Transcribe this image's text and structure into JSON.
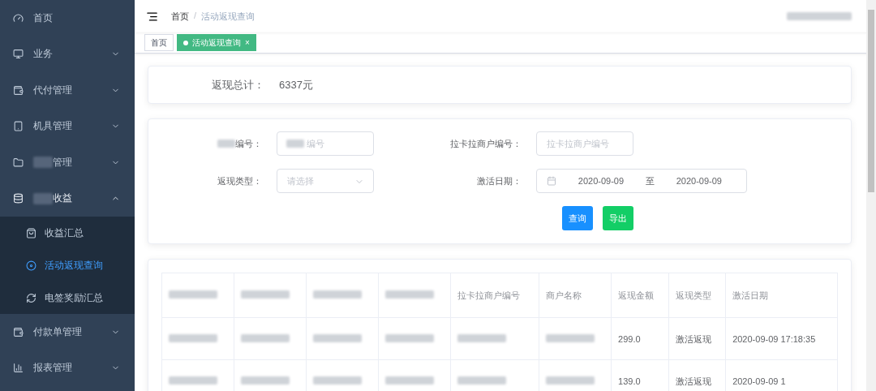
{
  "sidebar": {
    "items": [
      {
        "label": "首页",
        "masked": false
      },
      {
        "label": "业务",
        "masked": false,
        "expanded": false
      },
      {
        "label": "代付管理",
        "masked": false,
        "expanded": false
      },
      {
        "label": "机具管理",
        "masked": false,
        "expanded": false
      },
      {
        "label": "管理",
        "masked": true,
        "expanded": false
      },
      {
        "label": "收益",
        "masked": true,
        "expanded": true,
        "children": [
          {
            "label": "收益汇总",
            "selected": false
          },
          {
            "label": "活动返现查询",
            "selected": true
          },
          {
            "label": "电签奖励汇总",
            "selected": false
          }
        ]
      },
      {
        "label": "付款单管理",
        "masked": false,
        "expanded": false
      },
      {
        "label": "报表管理",
        "masked": false,
        "expanded": false
      }
    ]
  },
  "breadcrumb": {
    "items": [
      "首页",
      "活动返现查询"
    ],
    "separator": "/"
  },
  "header": {
    "user_masked": true
  },
  "tags": [
    {
      "label": "首页",
      "selected": false,
      "closable": false
    },
    {
      "label": "活动返现查询",
      "selected": true,
      "closable": true,
      "close": "×"
    }
  ],
  "summary": {
    "label": "返现总计：",
    "value": "6337元"
  },
  "filters": [
    {
      "kind": "input",
      "label": "编号：",
      "label_masked": true,
      "placeholder": "编号",
      "placeholder_masked": true
    },
    {
      "kind": "input",
      "label": "拉卡拉商户编号：",
      "label_masked": false,
      "placeholder": "拉卡拉商户编号",
      "placeholder_masked": false
    },
    {
      "kind": "select",
      "label": "返现类型：",
      "label_masked": false,
      "placeholder": "请选择",
      "placeholder_masked": false
    },
    {
      "kind": "daterange",
      "label": "激活日期：",
      "label_masked": false,
      "start": "2020-09-09",
      "separator": "至",
      "end": "2020-09-09"
    }
  ],
  "buttons": [
    {
      "label": "查询",
      "kind": "primary"
    },
    {
      "label": "导出",
      "kind": "success"
    }
  ],
  "table": {
    "columns": [
      {
        "masked": true
      },
      {
        "masked": true
      },
      {
        "masked": true
      },
      {
        "masked": true
      },
      {
        "masked": false,
        "text": "拉卡拉商户编号"
      },
      {
        "masked": false,
        "text": "商户名称"
      },
      {
        "masked": false,
        "text": "返现金额"
      },
      {
        "masked": false,
        "text": "返现类型"
      },
      {
        "masked": false,
        "text": "激活日期"
      }
    ],
    "rows": [
      [
        {
          "masked": true
        },
        {
          "masked": true
        },
        {
          "masked": true
        },
        {
          "masked": true
        },
        {
          "masked": true
        },
        {
          "masked": true
        },
        {
          "masked": false,
          "text": "299.0"
        },
        {
          "masked": false,
          "text": "激活返现"
        },
        {
          "masked": false,
          "text": "2020-09-09 17:18:35"
        }
      ],
      [
        {
          "masked": true
        },
        {
          "masked": true
        },
        {
          "masked": true
        },
        {
          "masked": true
        },
        {
          "masked": true
        },
        {
          "masked": true
        },
        {
          "masked": false,
          "text": "139.0"
        },
        {
          "masked": false,
          "text": "激活返现"
        },
        {
          "masked": false,
          "text": "2020-09-09 1"
        }
      ]
    ]
  }
}
